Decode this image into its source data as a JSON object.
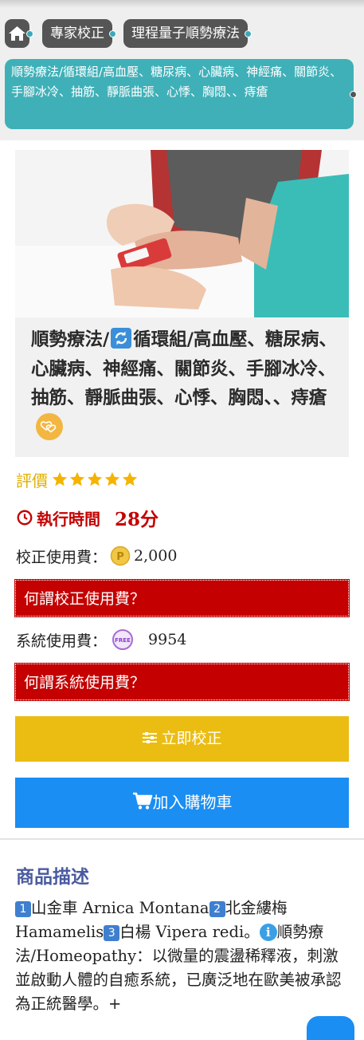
{
  "breadcrumb": {
    "items": [
      {
        "label": "專家校正"
      },
      {
        "label": "理程量子順勢療法"
      }
    ],
    "tag": "順勢療法/循環組/高血壓、糖尿病、心臟病、神經痛、關節炎、手腳冰冷、抽筋、靜脈曲張、心悸、胸悶、、痔瘡"
  },
  "product": {
    "title_before_icon": "順勢療法/",
    "title_after_icon": "循環組/高血壓、糖尿病、心臟病、神經痛、關節炎、手腳冰冷、抽筋、靜脈曲張、心悸、胸悶、、痔瘡",
    "rating_label": "評價",
    "rating_stars": 5,
    "exec_time_label": "執行時間",
    "exec_time_value": "28分",
    "fee_label": "校正使用費：",
    "fee_value": "2,000",
    "fee_question": "何謂校正使用費？",
    "system_fee_label": "系統使用費：",
    "system_fee_value": "9954",
    "system_fee_question": "何謂系統使用費？",
    "calibrate_button": "立即校正",
    "cart_button": "加入購物車"
  },
  "description": {
    "heading": "商品描述",
    "item1": "山金車 Arnica Montana",
    "item2": "北金縷梅 Hamamelis",
    "item3": "白楊 Vipera redi。",
    "body": "順勢療法/Homeopathy：以微量的震盪稀釋液，刺激並啟動人體的自癒系統，已廣泛地在歐美被承認為正統醫學。+"
  },
  "colors": {
    "teal": "#3fb0b8",
    "crumb": "#555555",
    "red": "#c40000",
    "gold_button": "#ebbd13",
    "blue_button": "#1a8ef2",
    "star": "#f4b400",
    "heading": "#4a5ba0"
  },
  "icons": [
    "home-icon",
    "sync-icon",
    "heart-badge-icon",
    "star-icon",
    "clock-icon",
    "points-coin-icon",
    "free-coin-icon",
    "sliders-icon",
    "cart-icon",
    "info-icon",
    "keycap-1-icon",
    "keycap-2-icon",
    "keycap-3-icon"
  ]
}
